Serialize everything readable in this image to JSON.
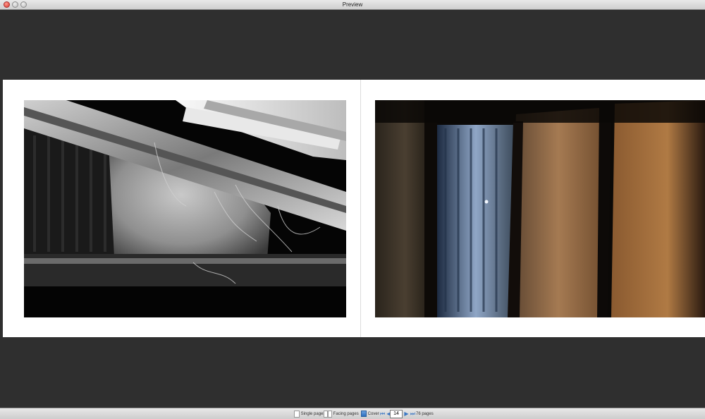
{
  "window": {
    "title": "Preview"
  },
  "toolbar": {
    "single_pages_label": "Single pages",
    "facing_pages_label": "Facing pages",
    "cover_label": "Cover",
    "page_number": "14",
    "total_pages_label": "76 pages",
    "icons": {
      "first": "first-page-icon",
      "prev": "previous-page-icon",
      "next": "next-page-icon",
      "last": "last-page-icon"
    }
  },
  "spread": {
    "left_photo": "black-and-white photo of roof beams and corrugated sheet",
    "right_photo": "color photo of rusted corrugated metal wall"
  }
}
